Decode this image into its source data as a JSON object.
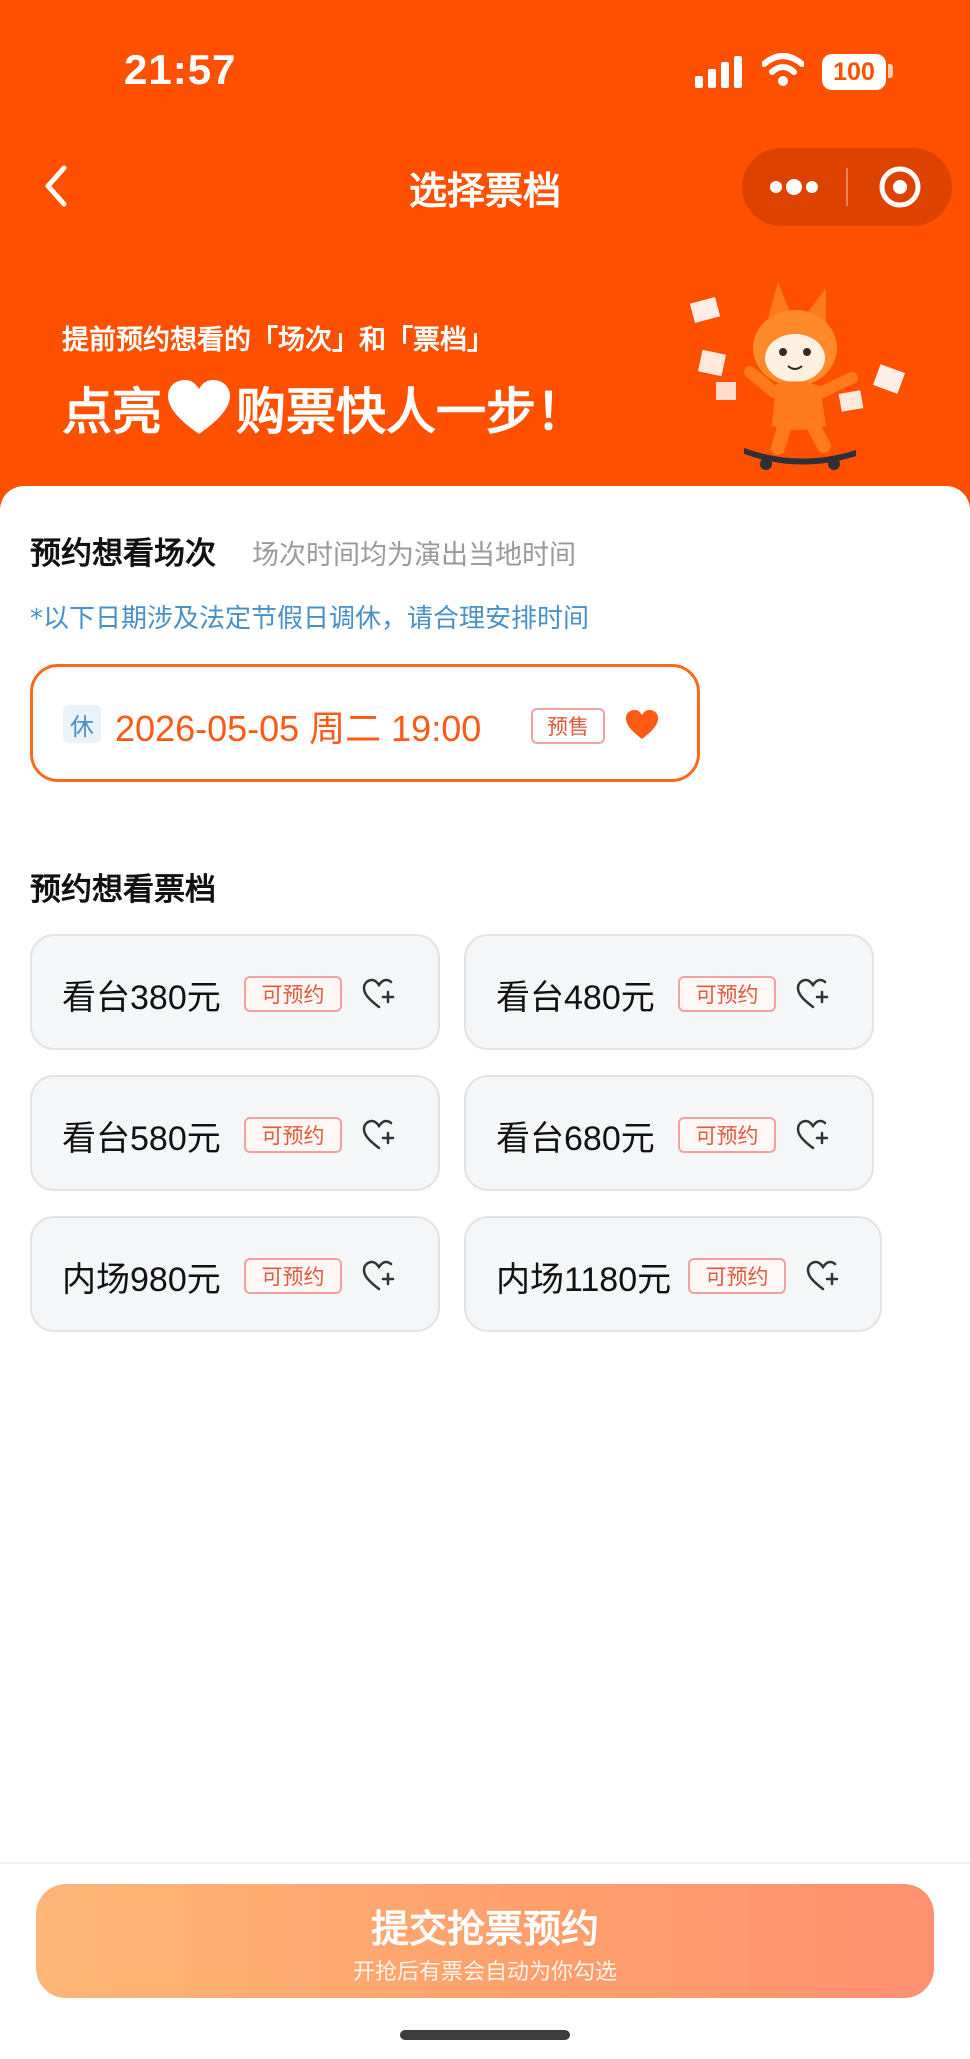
{
  "status_bar": {
    "time": "21:57",
    "battery": "100"
  },
  "nav": {
    "title": "选择票档"
  },
  "banner": {
    "line1": "提前预约想看的「场次」和「票档」",
    "line2_left": "点亮",
    "line2_right": "购票快人一步！"
  },
  "session_section": {
    "title": "预约想看场次",
    "subtitle": "场次时间均为演出当地时间",
    "notice": "*以下日期涉及法定节假日调休，请合理安排时间",
    "session": {
      "holiday_tag": "休",
      "datetime": "2026-05-05 周二 19:00",
      "status": "预售"
    }
  },
  "tier_section": {
    "title": "预约想看票档",
    "tiers": [
      {
        "name": "看台380元",
        "status": "可预约"
      },
      {
        "name": "看台480元",
        "status": "可预约"
      },
      {
        "name": "看台580元",
        "status": "可预约"
      },
      {
        "name": "看台680元",
        "status": "可预约"
      },
      {
        "name": "内场980元",
        "status": "可预约"
      },
      {
        "name": "内场1180元",
        "status": "可预约"
      }
    ]
  },
  "submit": {
    "label": "提交抢票预约",
    "sublabel": "开抢后有票会自动为你勾选"
  },
  "colors": {
    "brand": "#ff5000",
    "accent_orange": "#ff5a14",
    "notice_blue": "#4a90c8",
    "tag_red": "#e05a3a"
  },
  "icons": [
    "chevron-left-icon",
    "more-dots-icon",
    "close-target-icon",
    "heart-icon",
    "heart-add-icon",
    "signal-icon",
    "wifi-icon",
    "battery-icon"
  ]
}
